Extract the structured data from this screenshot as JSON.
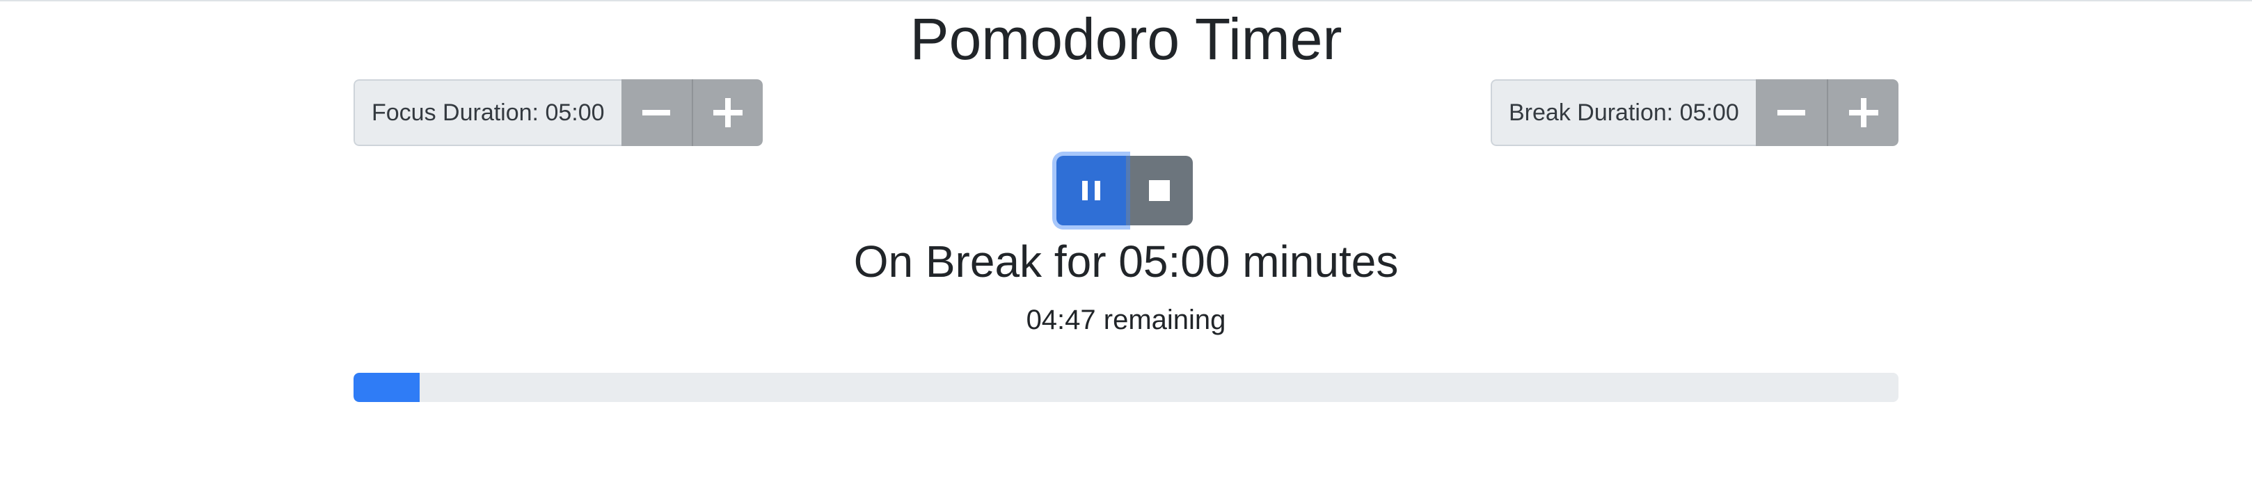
{
  "app": {
    "title": "Pomodoro Timer"
  },
  "focus": {
    "label": "Focus Duration: 05:00",
    "decrease_icon": "minus-icon",
    "increase_icon": "plus-icon"
  },
  "break": {
    "label": "Break Duration: 05:00",
    "decrease_icon": "minus-icon",
    "increase_icon": "plus-icon"
  },
  "controls": {
    "pause_icon": "pause-icon",
    "stop_icon": "stop-icon"
  },
  "status": {
    "heading": "On Break for 05:00 minutes",
    "remaining": "04:47 remaining"
  },
  "progress": {
    "fraction": 0.043
  },
  "colors": {
    "primary": "#2f6fd6",
    "progress_fill": "#2f7cf6",
    "secondary": "#6c757d",
    "stepper": "#a3a7ab",
    "track": "#e9ecef"
  }
}
